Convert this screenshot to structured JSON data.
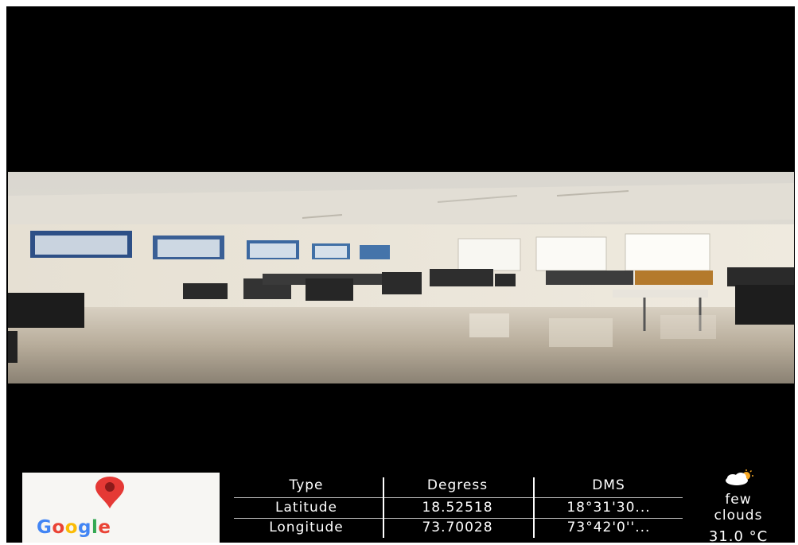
{
  "map_thumbnail": {
    "logo_text": "Google",
    "logo_colors": [
      "#4285F4",
      "#EA4335",
      "#FBBC05",
      "#4285F4",
      "#34A853",
      "#EA4335"
    ],
    "pin_color": "#E53935",
    "pin_icon": "map-pin-icon"
  },
  "geo_table": {
    "headers": [
      "Type",
      "Degress",
      "DMS"
    ],
    "rows": [
      {
        "type": "Latitude",
        "degrees": "18.52518",
        "dms": "18°31'30..."
      },
      {
        "type": "Longitude",
        "degrees": "73.70028",
        "dms": "73°42'0''..."
      }
    ]
  },
  "weather": {
    "icon": "partly-cloudy-icon",
    "condition_line1": "few",
    "condition_line2": "clouds",
    "temperature": "31.0 °C"
  }
}
